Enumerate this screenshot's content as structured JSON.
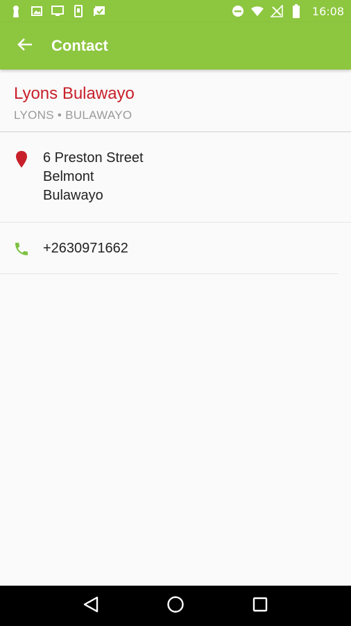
{
  "status_bar": {
    "time": "16:08",
    "left_icons": [
      "keyhole-icon",
      "image-icon",
      "monitor-icon",
      "phone-device-icon",
      "photos-check-icon"
    ],
    "right_icons": [
      "dnd-icon",
      "wifi-icon",
      "no-signal-icon",
      "battery-icon"
    ]
  },
  "app_bar": {
    "title": "Contact",
    "back_icon": "arrow-left-icon"
  },
  "contact": {
    "name": "Lyons Bulawayo",
    "subtitle": "LYONS • BULAWAYO",
    "address": {
      "line1": "6 Preston Street",
      "line2": "Belmont",
      "line3": "Bulawayo"
    },
    "phone": "+2630971662"
  },
  "colors": {
    "brand_green": "#8dc63f",
    "accent_red": "#c8202a",
    "phone_green": "#7dc242"
  },
  "nav_bar": {
    "icons": [
      "back-triangle-icon",
      "home-circle-icon",
      "recents-square-icon"
    ]
  }
}
